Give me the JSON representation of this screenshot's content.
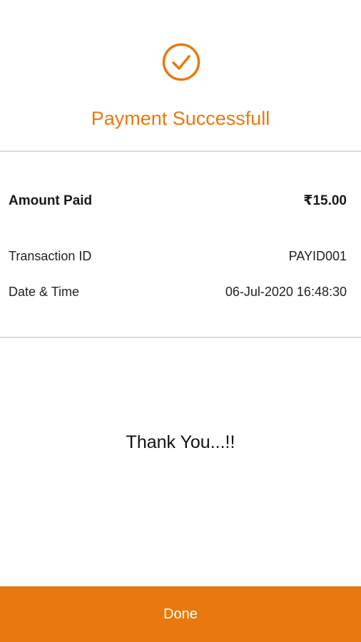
{
  "header": {
    "icon": "check-circle-icon",
    "title": "Payment Successfull"
  },
  "details": {
    "amount_label": "Amount Paid",
    "amount_value": "₹15.00",
    "transaction_label": "Transaction ID",
    "transaction_value": "PAYID001",
    "datetime_label": "Date & Time",
    "datetime_value": "06-Jul-2020 16:48:30"
  },
  "message": "Thank You...!!",
  "footer": {
    "done_label": "Done"
  },
  "colors": {
    "accent": "#e8790f",
    "divider": "#dcdcdc"
  }
}
